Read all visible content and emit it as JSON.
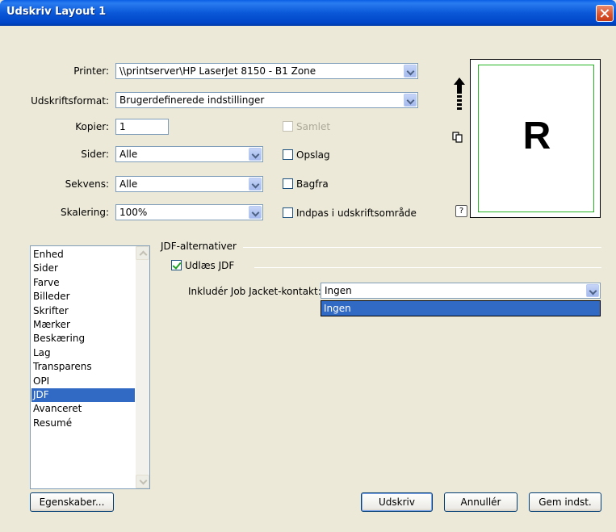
{
  "window": {
    "title": "Udskriv Layout 1"
  },
  "form": {
    "printer_label": "Printer:",
    "printer_value": "\\\\printserver\\HP LaserJet 8150 - B1 Zone",
    "format_label": "Udskriftsformat:",
    "format_value": "Brugerdefinerede indstillinger",
    "copies_label": "Kopier:",
    "copies_value": "1",
    "pages_label": "Sider:",
    "pages_value": "Alle",
    "sequence_label": "Sekvens:",
    "sequence_value": "Alle",
    "scaling_label": "Skalering:",
    "scaling_value": "100%"
  },
  "options": {
    "collate": {
      "label": "Samlet",
      "checked": false,
      "disabled": true
    },
    "spreads": {
      "label": "Opslag",
      "checked": false
    },
    "back_to_front": {
      "label": "Bagfra",
      "checked": false
    },
    "fit_print_area": {
      "label": "Indpas i udskriftsområde",
      "checked": false
    }
  },
  "preview": {
    "glyph": "R",
    "help": "?"
  },
  "sidebar": {
    "items": [
      {
        "label": "Enhed"
      },
      {
        "label": "Sider"
      },
      {
        "label": "Farve"
      },
      {
        "label": "Billeder"
      },
      {
        "label": "Skrifter"
      },
      {
        "label": "Mærker"
      },
      {
        "label": "Beskæring"
      },
      {
        "label": "Lag"
      },
      {
        "label": "Transparens"
      },
      {
        "label": "OPI"
      },
      {
        "label": "JDF",
        "selected": true
      },
      {
        "label": "Avanceret"
      },
      {
        "label": "Resumé"
      }
    ]
  },
  "jdf": {
    "group_title": "JDF-alternativer",
    "export_jdf_label": "Udlæs JDF",
    "export_jdf_checked": true,
    "contact_label": "Inkludér Job Jacket-kontakt:",
    "contact_value": "Ingen",
    "contact_options": [
      "Ingen"
    ]
  },
  "buttons": {
    "properties": "Egenskaber...",
    "print": "Udskriv",
    "cancel": "Annullér",
    "save_settings": "Gem indst."
  },
  "colors": {
    "title_bar": "#0a58d8",
    "selection": "#316ac5",
    "dialog_bg": "#ece9d8"
  }
}
